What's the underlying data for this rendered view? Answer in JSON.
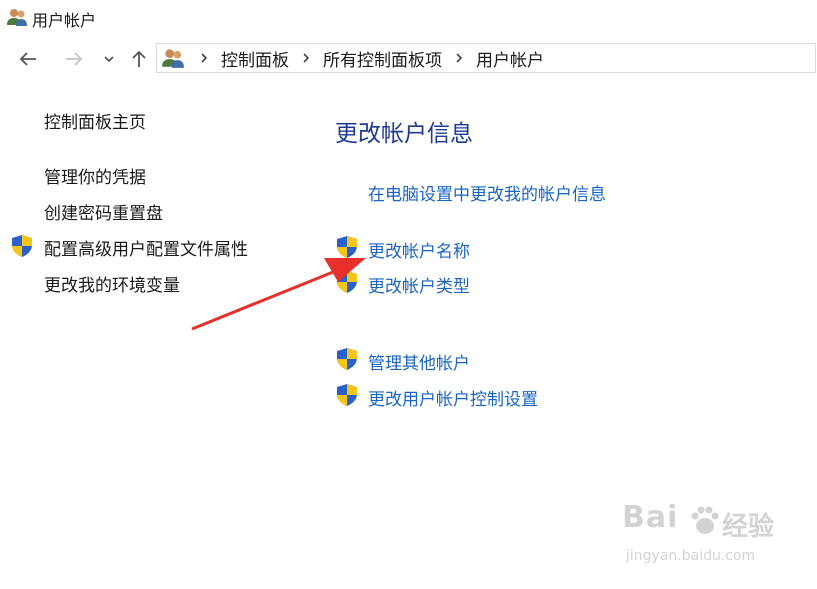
{
  "window": {
    "title": "用户帐户"
  },
  "icons": {
    "app": "users-icon",
    "back": "back-arrow-icon",
    "forward": "forward-arrow-icon",
    "recent": "chevron-down-icon",
    "up": "up-arrow-icon",
    "address": "users-icon",
    "separator": "chevron-right-icon",
    "uac": "uac-shield-icon"
  },
  "address_bar": {
    "crumbs": [
      "控制面板",
      "所有控制面板项",
      "用户帐户"
    ]
  },
  "sidebar": {
    "items": [
      {
        "label": "控制面板主页",
        "shield": false
      },
      {
        "label": "管理你的凭据",
        "shield": false
      },
      {
        "label": "创建密码重置盘",
        "shield": false
      },
      {
        "label": "配置高级用户配置文件属性",
        "shield": true
      },
      {
        "label": "更改我的环境变量",
        "shield": false
      }
    ]
  },
  "main": {
    "heading": "更改帐户信息",
    "tasks": [
      {
        "label": "在电脑设置中更改我的帐户信息",
        "shield": false
      },
      {
        "label": "更改帐户名称",
        "shield": true
      },
      {
        "label": "更改帐户类型",
        "shield": true
      },
      {
        "label": "管理其他帐户",
        "shield": true
      },
      {
        "label": "更改用户帐户控制设置",
        "shield": true
      }
    ]
  },
  "watermark": {
    "logo": "Bai",
    "logo_suffix": "经验",
    "url": "jingyan.baidu.com"
  },
  "colors": {
    "link": "#1a64c2",
    "heading": "#1f3b8f",
    "annotation_arrow": "#e8302a"
  }
}
